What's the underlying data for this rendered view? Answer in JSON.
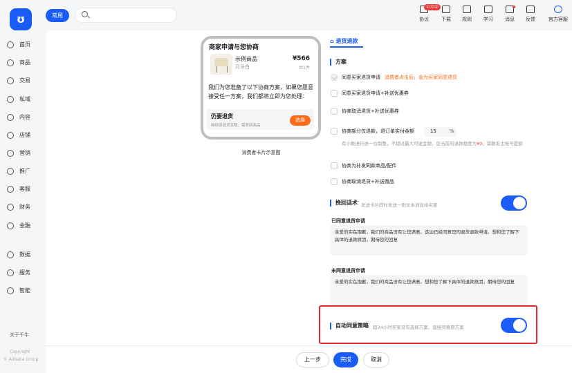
{
  "header": {
    "logo": "ʊ",
    "tab_common": "常用",
    "search_placeholder": "",
    "badge": "公示中",
    "tools": [
      {
        "label": "协议",
        "icon": "agreement-icon"
      },
      {
        "label": "下载",
        "icon": "download-icon"
      },
      {
        "label": "规则",
        "icon": "rules-icon"
      },
      {
        "label": "学习",
        "icon": "study-icon"
      },
      {
        "label": "消息",
        "icon": "message-icon"
      },
      {
        "label": "反馈",
        "icon": "feedback-icon"
      },
      {
        "label": "官方客服",
        "icon": "service-icon"
      }
    ]
  },
  "sidebar": {
    "items": [
      {
        "label": "首页",
        "icon": "home-icon"
      },
      {
        "label": "商品",
        "icon": "goods-icon"
      },
      {
        "label": "交易",
        "icon": "trade-icon"
      },
      {
        "label": "私域",
        "icon": "private-domain-icon"
      },
      {
        "label": "内容",
        "icon": "content-icon"
      },
      {
        "label": "店铺",
        "icon": "shop-icon"
      },
      {
        "label": "营销",
        "icon": "marketing-icon"
      },
      {
        "label": "推广",
        "icon": "promotion-icon"
      },
      {
        "label": "客服",
        "icon": "customer-service-icon"
      },
      {
        "label": "财务",
        "icon": "finance-icon"
      },
      {
        "label": "金融",
        "icon": "banking-icon"
      },
      {
        "label": "数据",
        "icon": "data-icon"
      },
      {
        "label": "服务",
        "icon": "services-icon"
      },
      {
        "label": "智能",
        "icon": "smart-icon"
      }
    ],
    "about": "关于千牛",
    "copyright1": "Copyright",
    "copyright2": "© Alibaba Group"
  },
  "card": {
    "title": "商家申请与您协商",
    "product_name": "示例商品",
    "product_sub": "月牙白",
    "price": "¥566",
    "qty": "共1件",
    "message": "我们为您准备了以下协商方案，如果您愿意接受任一方案，我们都将立即为您处理：",
    "option_title": "仍要退货",
    "option_sub": "继续原退货流程，需寄回商品",
    "option_button": "选择",
    "caption": "消费者卡片示意图"
  },
  "settings": {
    "tab": "退货退款",
    "plan_title": "方案",
    "options": [
      {
        "label": "同意买家退货申请",
        "hint": "消费者点击后，会为买家同意退货",
        "checked": true
      },
      {
        "label": "同意买家退货申请+补送优惠券",
        "hint": "",
        "checked": false
      },
      {
        "label": "协商取消退货+补送优惠券",
        "hint": "",
        "checked": false
      },
      {
        "label": "协商部分仅退款，退订单实付金额",
        "hint": "",
        "checked": false
      },
      {
        "label": "协商为补发同款商品/配件",
        "hint": "",
        "checked": false
      },
      {
        "label": "协商取消退货+补送赠品",
        "hint": "",
        "checked": false
      }
    ],
    "percent_value": "15",
    "percent_unit": "%",
    "partial_note_a": "有小数进行进一位取整，不超过最大可退金额，您当前的退款额度为",
    "partial_note_amount": "¥0",
    "partial_note_b": "，需联系主账号提额",
    "recover_title": "挽回话术",
    "recover_desc": "发送卡片同时发送一则文本消息给买家",
    "recover_enabled": true,
    "agreed_title": "已同意退货申请",
    "agreed_text": "亲爱的实在抱歉，我们的商品没有让您满意。这边已经同意您的退货退款申请。想和您了解下具体的退款原因，期待您的回复",
    "unagreed_title": "未同意退货申请",
    "unagreed_text": "亲爱的实在抱歉，我们的商品没有让您满意。想和您了解下具体的退款原因，期待您的回复",
    "auto_title": "自动同意策略",
    "auto_desc": "超24小时买家没有选择方案，直接同意原方案",
    "auto_enabled": true
  },
  "footer": {
    "prev": "上一步",
    "done": "完成",
    "cancel": "取消"
  }
}
